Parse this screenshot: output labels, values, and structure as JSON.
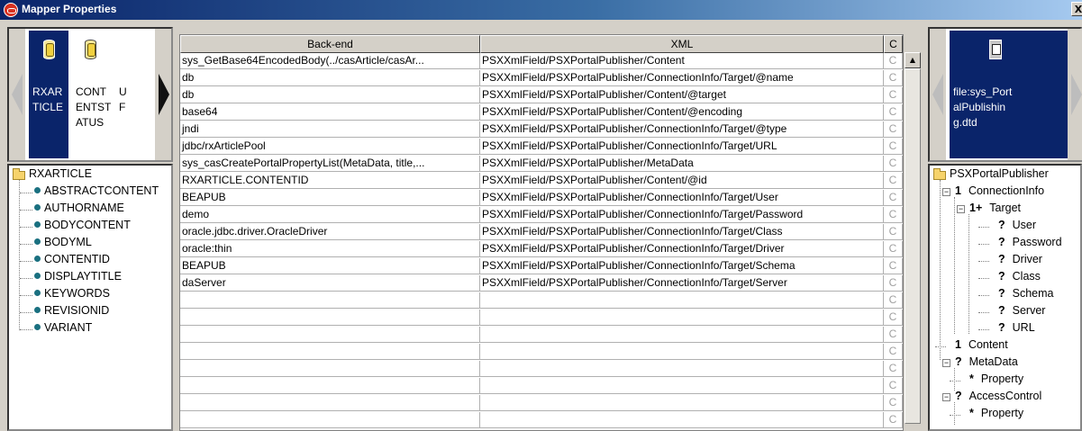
{
  "window": {
    "title": "Mapper Properties",
    "close_label": "X"
  },
  "source": {
    "tiles": [
      "RXARTICLE",
      "CONTENTSTATUS",
      "UF"
    ],
    "tree_root": "RXARTICLE",
    "fields": [
      "ABSTRACTCONTENT",
      "AUTHORNAME",
      "BODYCONTENT",
      "BODYML",
      "CONTENTID",
      "DISPLAYTITLE",
      "KEYWORDS",
      "REVISIONID",
      "VARIANT"
    ]
  },
  "grid": {
    "headers": [
      "Back-end",
      "XML",
      "C"
    ],
    "cond_glyph": "C",
    "rows": [
      {
        "backend": "sys_GetBase64EncodedBody(../casArticle/casAr...",
        "xml": "PSXXmlField/PSXPortalPublisher/Content"
      },
      {
        "backend": "db",
        "xml": "PSXXmlField/PSXPortalPublisher/ConnectionInfo/Target/@name"
      },
      {
        "backend": "db",
        "xml": "PSXXmlField/PSXPortalPublisher/Content/@target"
      },
      {
        "backend": "base64",
        "xml": "PSXXmlField/PSXPortalPublisher/Content/@encoding"
      },
      {
        "backend": "jndi",
        "xml": "PSXXmlField/PSXPortalPublisher/ConnectionInfo/Target/@type"
      },
      {
        "backend": "jdbc/rxArticlePool",
        "xml": "PSXXmlField/PSXPortalPublisher/ConnectionInfo/Target/URL"
      },
      {
        "backend": "sys_casCreatePortalPropertyList(MetaData, title,...",
        "xml": "PSXXmlField/PSXPortalPublisher/MetaData"
      },
      {
        "backend": "RXARTICLE.CONTENTID",
        "xml": "PSXXmlField/PSXPortalPublisher/Content/@id"
      },
      {
        "backend": "BEAPUB",
        "xml": "PSXXmlField/PSXPortalPublisher/ConnectionInfo/Target/User"
      },
      {
        "backend": "demo",
        "xml": "PSXXmlField/PSXPortalPublisher/ConnectionInfo/Target/Password"
      },
      {
        "backend": "oracle.jdbc.driver.OracleDriver",
        "xml": "PSXXmlField/PSXPortalPublisher/ConnectionInfo/Target/Class"
      },
      {
        "backend": "oracle:thin",
        "xml": "PSXXmlField/PSXPortalPublisher/ConnectionInfo/Target/Driver"
      },
      {
        "backend": "BEAPUB",
        "xml": "PSXXmlField/PSXPortalPublisher/ConnectionInfo/Target/Schema"
      },
      {
        "backend": "daServer",
        "xml": "PSXXmlField/PSXPortalPublisher/ConnectionInfo/Target/Server"
      }
    ],
    "empty_rows": 8
  },
  "target": {
    "tile": "file:sys_PortalPublishing.dtd",
    "tree": [
      {
        "label": "PSXPortalPublisher",
        "marker": ""
      },
      {
        "label": "ConnectionInfo",
        "marker": "1"
      },
      {
        "label": "Target",
        "marker": "1+"
      },
      {
        "label": "User",
        "marker": "?"
      },
      {
        "label": "Password",
        "marker": "?"
      },
      {
        "label": "Driver",
        "marker": "?"
      },
      {
        "label": "Class",
        "marker": "?"
      },
      {
        "label": "Schema",
        "marker": "?"
      },
      {
        "label": "Server",
        "marker": "?"
      },
      {
        "label": "URL",
        "marker": "?"
      },
      {
        "label": "Content",
        "marker": "1"
      },
      {
        "label": "MetaData",
        "marker": "?"
      },
      {
        "label": "Property",
        "marker": "*"
      },
      {
        "label": "AccessControl",
        "marker": "?"
      },
      {
        "label": "Property",
        "marker": "*"
      }
    ]
  }
}
